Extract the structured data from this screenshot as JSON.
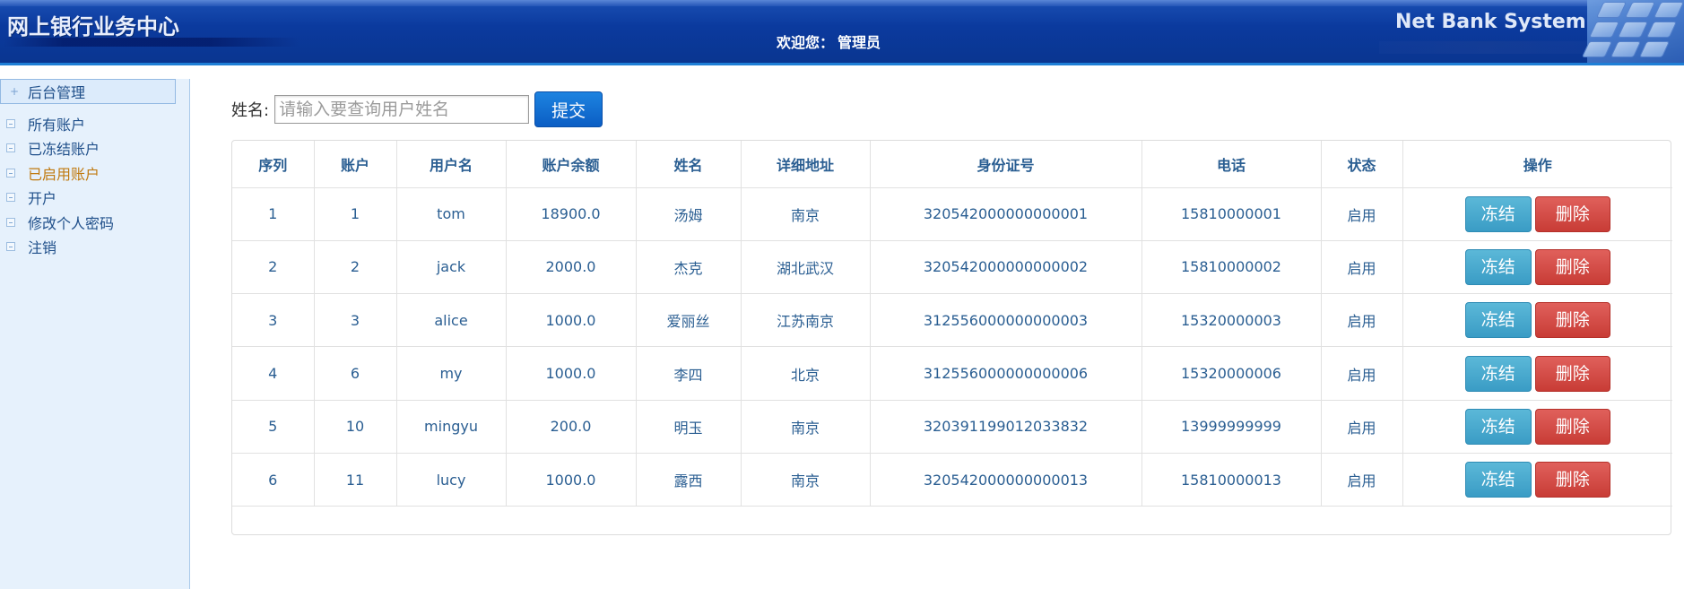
{
  "header": {
    "title": "网上银行业务中心",
    "welcome_prefix": "欢迎您：",
    "welcome_user": "管理员",
    "brand": "Net Bank System"
  },
  "sidebar": {
    "section_title": "后台管理",
    "items": [
      {
        "label": "所有账户",
        "active": false
      },
      {
        "label": "已冻结账户",
        "active": false
      },
      {
        "label": "已启用账户",
        "active": true
      },
      {
        "label": "开户",
        "active": false
      },
      {
        "label": "修改个人密码",
        "active": false
      },
      {
        "label": "注销",
        "active": false
      }
    ]
  },
  "search": {
    "label": "姓名:",
    "placeholder": "请输入要查询用户姓名",
    "value": "",
    "submit_label": "提交"
  },
  "table": {
    "columns": [
      "序列",
      "账户",
      "用户名",
      "账户余额",
      "姓名",
      "详细地址",
      "身份证号",
      "电话",
      "状态",
      "操作"
    ],
    "rows": [
      {
        "seq": "1",
        "account": "1",
        "username": "tom",
        "balance": "18900.0",
        "name": "汤姆",
        "address": "南京",
        "id_number": "320542000000000001",
        "phone": "15810000001",
        "status": "启用"
      },
      {
        "seq": "2",
        "account": "2",
        "username": "jack",
        "balance": "2000.0",
        "name": "杰克",
        "address": "湖北武汉",
        "id_number": "320542000000000002",
        "phone": "15810000002",
        "status": "启用"
      },
      {
        "seq": "3",
        "account": "3",
        "username": "alice",
        "balance": "1000.0",
        "name": "爱丽丝",
        "address": "江苏南京",
        "id_number": "312556000000000003",
        "phone": "15320000003",
        "status": "启用"
      },
      {
        "seq": "4",
        "account": "6",
        "username": "my",
        "balance": "1000.0",
        "name": "李四",
        "address": "北京",
        "id_number": "312556000000000006",
        "phone": "15320000006",
        "status": "启用"
      },
      {
        "seq": "5",
        "account": "10",
        "username": "mingyu",
        "balance": "200.0",
        "name": "明玉",
        "address": "南京",
        "id_number": "320391199012033832",
        "phone": "13999999999",
        "status": "启用"
      },
      {
        "seq": "6",
        "account": "11",
        "username": "lucy",
        "balance": "1000.0",
        "name": "露西",
        "address": "南京",
        "id_number": "320542000000000013",
        "phone": "15810000013",
        "status": "启用"
      }
    ],
    "freeze_label": "冻结",
    "delete_label": "删除"
  },
  "colors": {
    "header_blue": "#0b3a9e",
    "text_blue": "#2a5e92",
    "active_orange": "#c07a10",
    "freeze_btn": "#3a9cc5",
    "delete_btn": "#c83c36",
    "submit_btn": "#0b5ec4"
  }
}
